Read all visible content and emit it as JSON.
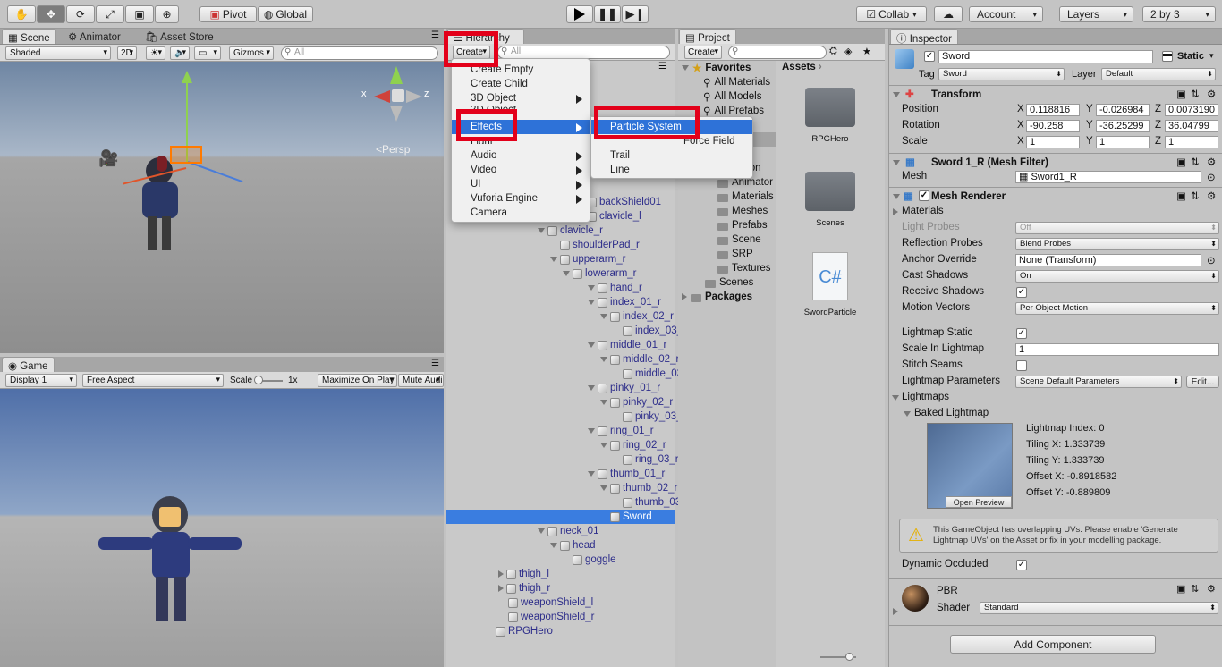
{
  "toolbar": {
    "pivot": "Pivot",
    "global": "Global",
    "collab": "Collab",
    "account": "Account",
    "layers": "Layers",
    "layout": "2 by 3"
  },
  "scene": {
    "tabs": [
      "Scene",
      "Animator",
      "Asset Store"
    ],
    "shading": "Shaded",
    "mode_2d": "2D",
    "gizmos": "Gizmos",
    "search_placeholder": "All",
    "persp_label": "Persp",
    "axis_x": "x",
    "axis_z": "z"
  },
  "game": {
    "tab": "Game",
    "display": "Display 1",
    "aspect": "Free Aspect",
    "scale_label": "Scale",
    "scale_value": "1x",
    "maximize": "Maximize On Play",
    "mute": "Mute Audi"
  },
  "hierarchy": {
    "tab": "Hierarchy",
    "create": "Create",
    "search_placeholder": "All",
    "rows": [
      {
        "label": "backShield01",
        "depth": 0
      },
      {
        "label": "clavicle_l",
        "depth": 0
      },
      {
        "label": "clavicle_r",
        "depth": 1
      },
      {
        "label": "shoulderPad_r",
        "depth": 2
      },
      {
        "label": "upperarm_r",
        "depth": 2
      },
      {
        "label": "lowerarm_r",
        "depth": 3
      },
      {
        "label": "hand_r",
        "depth": 4
      },
      {
        "label": "index_01_r",
        "depth": 5
      },
      {
        "label": "index_02_r",
        "depth": 6
      },
      {
        "label": "index_03_r",
        "depth": 7
      },
      {
        "label": "middle_01_r",
        "depth": 5
      },
      {
        "label": "middle_02_r",
        "depth": 6
      },
      {
        "label": "middle_03_r",
        "depth": 7
      },
      {
        "label": "pinky_01_r",
        "depth": 5
      },
      {
        "label": "pinky_02_r",
        "depth": 6
      },
      {
        "label": "pinky_03_r",
        "depth": 7
      },
      {
        "label": "ring_01_r",
        "depth": 5
      },
      {
        "label": "ring_02_r",
        "depth": 6
      },
      {
        "label": "ring_03_r",
        "depth": 7
      },
      {
        "label": "thumb_01_r",
        "depth": 5
      },
      {
        "label": "thumb_02_r",
        "depth": 6
      },
      {
        "label": "thumb_03_r",
        "depth": 7
      },
      {
        "label": "Sword",
        "depth": 6
      },
      {
        "label": "neck_01",
        "depth": 1
      },
      {
        "label": "head",
        "depth": 2
      },
      {
        "label": "goggle",
        "depth": 3
      },
      {
        "label": "thigh_l",
        "depth": -1
      },
      {
        "label": "thigh_r",
        "depth": -1
      },
      {
        "label": "weaponShield_l",
        "depth": -2
      },
      {
        "label": "weaponShield_r",
        "depth": -2
      },
      {
        "label": "RPGHero",
        "depth": -3
      }
    ]
  },
  "create_menu": {
    "items": [
      "Create Empty",
      "Create Child",
      "3D Object",
      "2D Object",
      "Effects",
      "Light",
      "Audio",
      "Video",
      "UI",
      "Vuforia Engine",
      "Camera"
    ],
    "effects_sub": [
      "Particle System",
      "Force Field",
      "Trail",
      "Line"
    ]
  },
  "project": {
    "tab": "Project",
    "create": "Create",
    "favorites": "Favorites",
    "fav_items": [
      "All Materials",
      "All Models",
      "All Prefabs"
    ],
    "tree_partial": [
      "ro",
      "mation",
      "Animator",
      "Materials",
      "Meshes",
      "Prefabs",
      "Scene",
      "SRP",
      "Textures"
    ],
    "scenes": "Scenes",
    "packages": "Packages",
    "assets_label": "Assets",
    "assets": [
      "RPGHero",
      "Scenes",
      "SwordParticle"
    ],
    "cs_label": "C#"
  },
  "inspector": {
    "tab": "Inspector",
    "name": "Sword",
    "static": "Static",
    "tag_label": "Tag",
    "tag": "Sword",
    "layer_label": "Layer",
    "layer": "Default",
    "transform": {
      "title": "Transform",
      "position_label": "Position",
      "rotation_label": "Rotation",
      "scale_label": "Scale",
      "position": [
        "0.118816",
        "-0.026984",
        "0.0073190"
      ],
      "rotation": [
        "-90.258",
        "-36.25299",
        "36.04799"
      ],
      "scale": [
        "1",
        "1",
        "1"
      ],
      "x": "X",
      "y": "Y",
      "z": "Z"
    },
    "mesh_filter": {
      "title": "Sword 1_R (Mesh Filter)",
      "mesh_label": "Mesh",
      "mesh": "Sword1_R"
    },
    "mesh_renderer": {
      "title": "Mesh Renderer",
      "materials": "Materials",
      "light_probes_label": "Light Probes",
      "light_probes": "Off",
      "reflection_label": "Reflection Probes",
      "reflection": "Blend Probes",
      "anchor_label": "Anchor Override",
      "anchor": "None (Transform)",
      "cast_label": "Cast Shadows",
      "cast": "On",
      "receive_label": "Receive Shadows",
      "motion_label": "Motion Vectors",
      "motion": "Per Object Motion",
      "lm_static_label": "Lightmap Static",
      "scale_lm_label": "Scale In Lightmap",
      "scale_lm": "1",
      "stitch_label": "Stitch Seams",
      "lm_params_label": "Lightmap Parameters",
      "lm_params": "Scene Default Parameters",
      "edit": "Edit...",
      "lightmaps": "Lightmaps",
      "baked": "Baked Lightmap",
      "open_preview": "Open Preview",
      "lm_index": "Lightmap Index: 0",
      "tiling_x": "Tiling X: 1.333739",
      "tiling_y": "Tiling Y: 1.333739",
      "offset_x": "Offset X: -0.8918582",
      "offset_y": "Offset Y: -0.889809",
      "warning": "This GameObject has overlapping UVs. Please enable 'Generate Lightmap UVs' on the Asset or fix in your modelling package.",
      "dyn_occluded_label": "Dynamic Occluded"
    },
    "material": {
      "name": "PBR",
      "shader_label": "Shader",
      "shader": "Standard"
    },
    "add_component": "Add Component"
  },
  "colors": {
    "selection": "#2e72d8",
    "highlight": "#e3001a",
    "link_text": "#2d2d8a"
  }
}
